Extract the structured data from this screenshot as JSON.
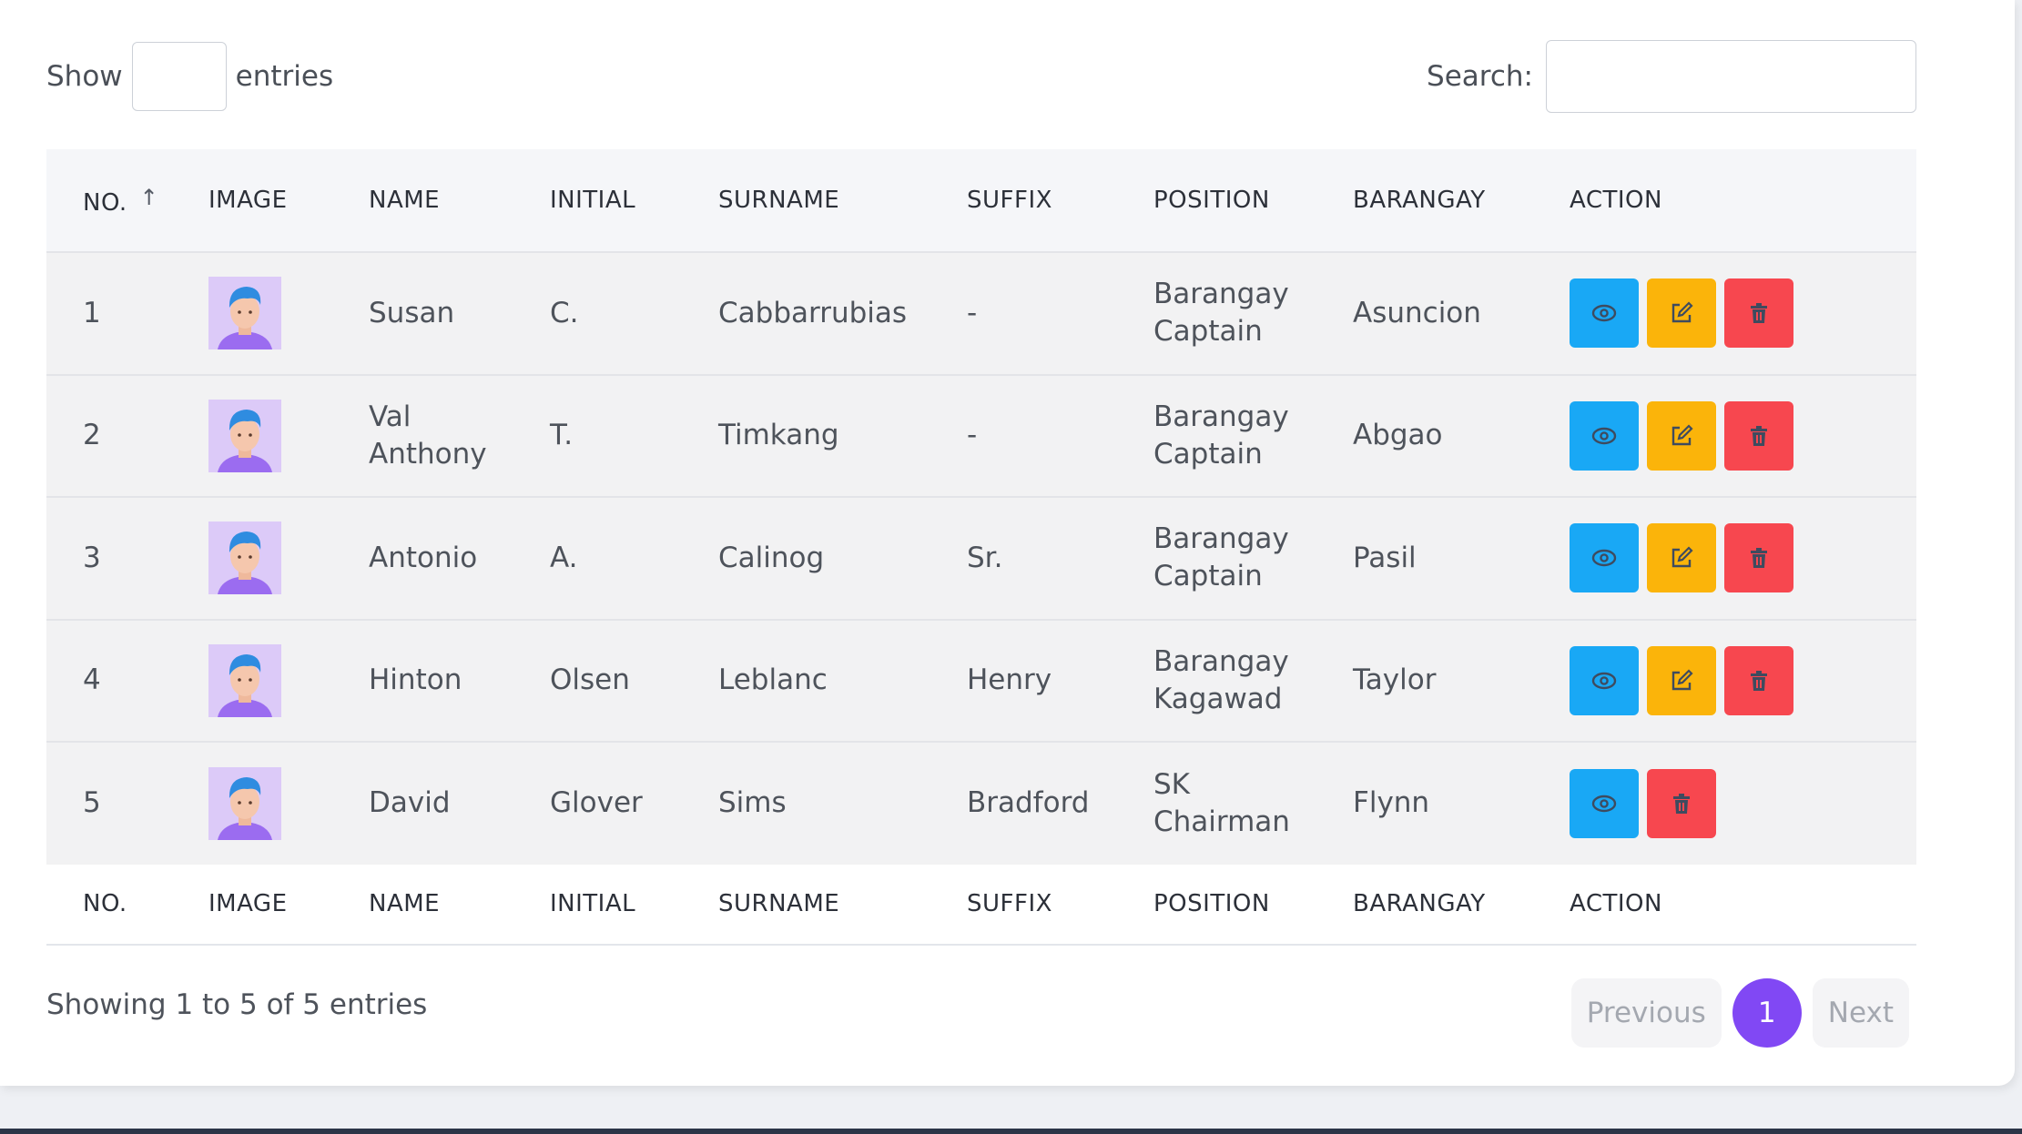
{
  "controls": {
    "show_label": "Show",
    "entries_label": "entries",
    "search_label": "Search:",
    "length_value": "",
    "search_value": ""
  },
  "table": {
    "columns": [
      "NO.",
      "IMAGE",
      "NAME",
      "INITIAL",
      "SURNAME",
      "SUFFIX",
      "POSITION",
      "BARANGAY",
      "ACTION"
    ],
    "rows": [
      {
        "no": "1",
        "name": "Susan",
        "initial": "C.",
        "surname": "Cabbarrubias",
        "suffix": "-",
        "position": "Barangay Captain",
        "barangay": "Asuncion",
        "actions": [
          "view",
          "edit",
          "delete"
        ]
      },
      {
        "no": "2",
        "name": "Val Anthony",
        "initial": "T.",
        "surname": "Timkang",
        "suffix": "-",
        "position": "Barangay Captain",
        "barangay": "Abgao",
        "actions": [
          "view",
          "edit",
          "delete"
        ]
      },
      {
        "no": "3",
        "name": "Antonio",
        "initial": "A.",
        "surname": "Calinog",
        "suffix": "Sr.",
        "position": "Barangay Captain",
        "barangay": "Pasil",
        "actions": [
          "view",
          "edit",
          "delete"
        ]
      },
      {
        "no": "4",
        "name": "Hinton",
        "initial": "Olsen",
        "surname": "Leblanc",
        "suffix": "Henry",
        "position": "Barangay Kagawad",
        "barangay": "Taylor",
        "actions": [
          "view",
          "edit",
          "delete"
        ]
      },
      {
        "no": "5",
        "name": "David",
        "initial": "Glover",
        "surname": "Sims",
        "suffix": "Bradford",
        "position": "SK Chairman",
        "barangay": "Flynn",
        "actions": [
          "view",
          "delete"
        ]
      }
    ],
    "sort_icon": "arrow-up-icon"
  },
  "footer": {
    "info": "Showing 1 to 5 of 5 entries",
    "previous_label": "Previous",
    "current_page": "1",
    "next_label": "Next"
  },
  "colors": {
    "view": "#19a8f5",
    "edit": "#fbb40a",
    "delete": "#f7474f",
    "page_active": "#8148f4"
  }
}
